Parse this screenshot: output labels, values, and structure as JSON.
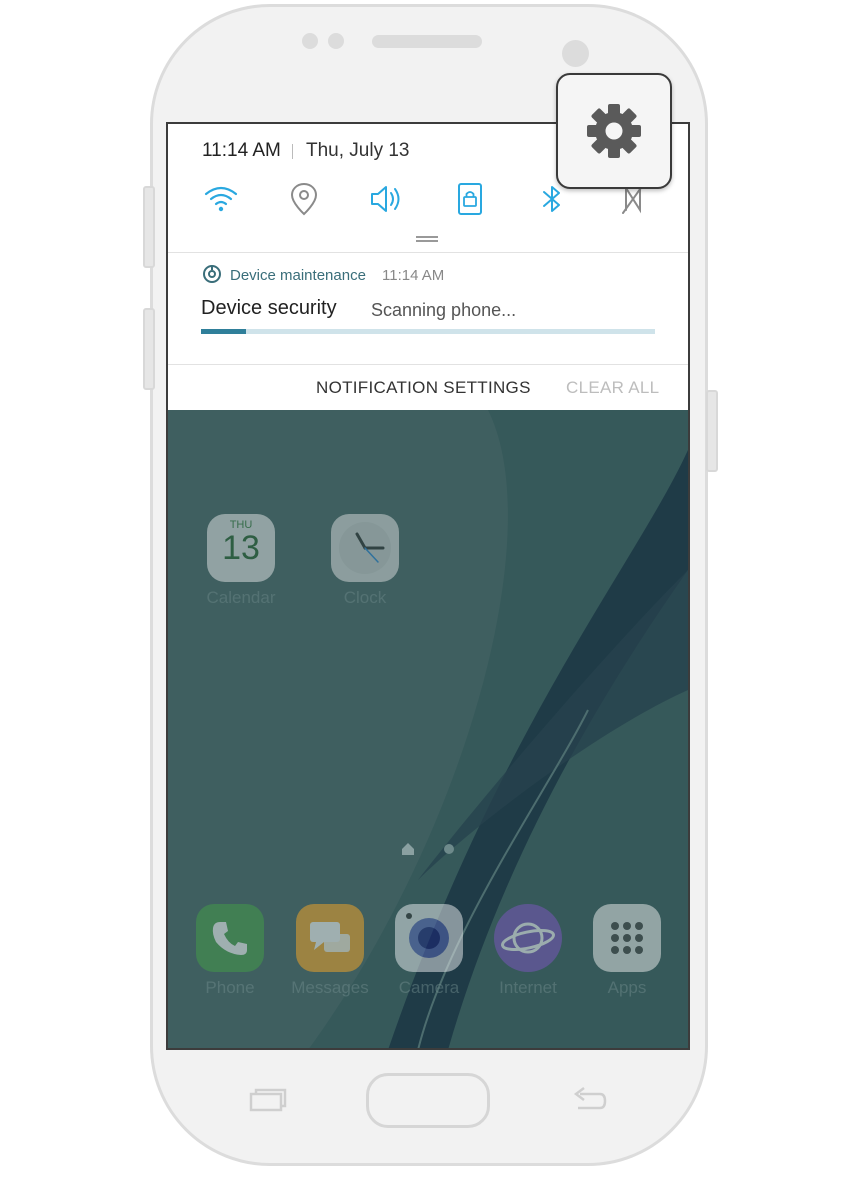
{
  "status": {
    "time": "11:14 AM",
    "date": "Thu, July 13"
  },
  "quick_settings": [
    "wifi-icon",
    "location-icon",
    "sound-icon",
    "screen-rotation-lock-icon",
    "bluetooth-icon",
    "nfc-icon"
  ],
  "notification": {
    "app": "Device maintenance",
    "time": "11:14 AM",
    "title": "Device security",
    "text": "Scanning phone...",
    "progress": 0.1
  },
  "actions": {
    "settings": "NOTIFICATION SETTINGS",
    "clear": "CLEAR ALL"
  },
  "home": {
    "calendar": {
      "day": "THU",
      "date": "13",
      "label": "Calendar"
    },
    "clock": {
      "label": "Clock"
    },
    "dock": [
      {
        "label": "Phone",
        "icon": "phone-icon"
      },
      {
        "label": "Messages",
        "icon": "messages-icon"
      },
      {
        "label": "Camera",
        "icon": "camera-icon"
      },
      {
        "label": "Internet",
        "icon": "internet-icon"
      },
      {
        "label": "Apps",
        "icon": "apps-grid-icon"
      }
    ]
  },
  "colors": {
    "accent": "#29a8e0",
    "progress": "#2f7f9a",
    "wallpaper": "#3d5c5e"
  }
}
